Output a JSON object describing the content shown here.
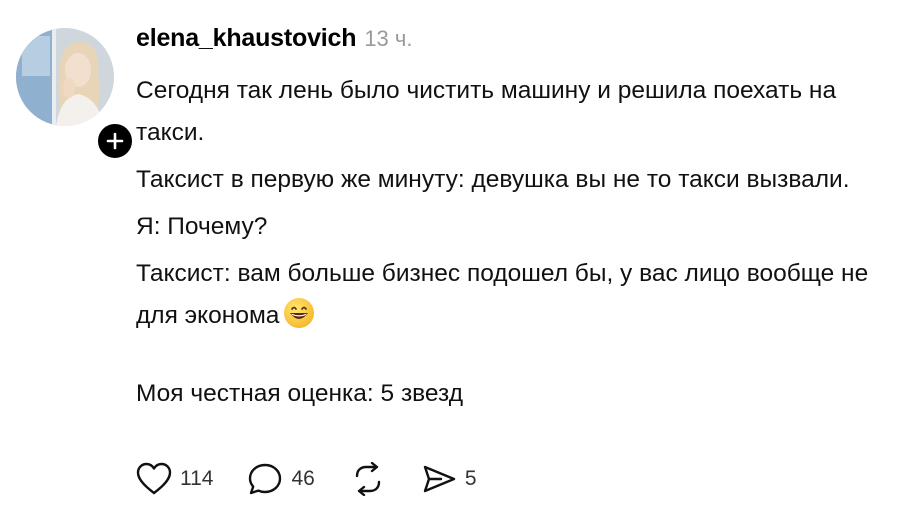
{
  "post": {
    "username": "elena_khaustovich",
    "time": "13 ч.",
    "paragraphs": [
      "Сегодня так лень было чистить машину и решила поехать на такси.",
      "Таксист в первую же минуту: девушка вы не то такси вызвали.",
      "Я: Почему?",
      "Таксист: вам больше бизнес подошел бы, у вас лицо вообще не для эконома"
    ],
    "emoji": "grinning-face-emoji",
    "rating_text": "Моя честная оценка: 5 звезд"
  },
  "actions": {
    "likes": "114",
    "replies": "46",
    "shares": "5"
  },
  "icons": {
    "avatar": "profile-photo",
    "follow": "plus-icon",
    "like": "heart-icon",
    "reply": "speech-bubble-icon",
    "repost": "repost-icon",
    "share": "send-icon"
  },
  "colors": {
    "text": "#111111",
    "muted": "#9a9a9a",
    "badge": "#000000"
  }
}
